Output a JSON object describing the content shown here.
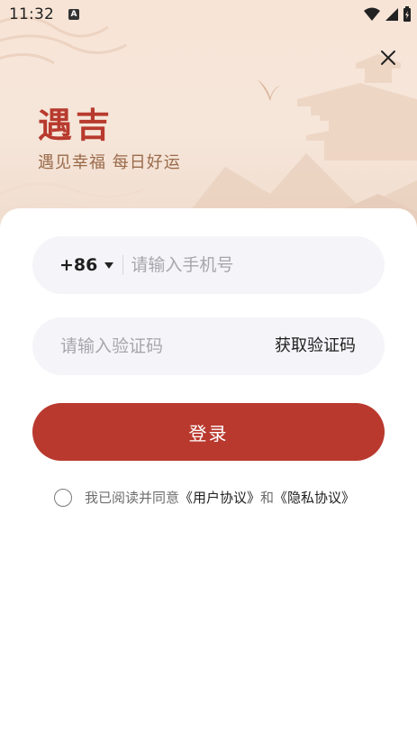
{
  "status_bar": {
    "time": "11:32",
    "notification_badge": "A",
    "icons": [
      "wifi-icon",
      "cellular-icon",
      "battery-charging-icon"
    ]
  },
  "hero": {
    "title": "遇吉",
    "subtitle": "遇见幸福 每日好运",
    "close_icon": "close-icon"
  },
  "login": {
    "country_code": "+86",
    "phone_placeholder": "请输入手机号",
    "code_placeholder": "请输入验证码",
    "get_code_label": "获取验证码",
    "login_label": "登录"
  },
  "agreement": {
    "prefix": "我已阅读并同意",
    "user_agreement": "《用户协议》",
    "conjunction": "和",
    "privacy_policy": "《隐私协议》"
  },
  "colors": {
    "accent": "#b9392e",
    "hero_bg": "#f6e6da",
    "field_bg": "#f5f4f8",
    "subtitle": "#9a6a4a"
  }
}
